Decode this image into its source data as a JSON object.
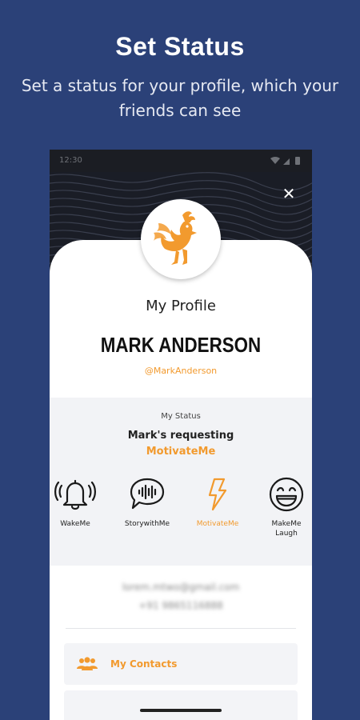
{
  "promo": {
    "title": "Set Status",
    "subtitle": "Set a status for your profile, which your friends can see"
  },
  "status_bar": {
    "time": "12:30"
  },
  "profile": {
    "heading": "My Profile",
    "name": "MARK ANDERSON",
    "handle": "@MarkAnderson"
  },
  "status": {
    "title": "My Status",
    "line": "Mark's  requesting",
    "value": "MotivateMe",
    "options": [
      {
        "label": "WakeMe",
        "icon": "bell-icon"
      },
      {
        "label": "StorywithMe",
        "icon": "speech-bubble-waveform-icon"
      },
      {
        "label": "MotivateMe",
        "icon": "lightning-bolt-icon",
        "selected": true
      },
      {
        "label": "MakeMe Laugh",
        "icon": "laughing-face-icon"
      }
    ]
  },
  "contact_info": {
    "email": "lorem.mtwo@gmail.com",
    "phone": "+91 9865116888"
  },
  "menu": {
    "contacts_label": "My Contacts"
  },
  "colors": {
    "background": "#2b4178",
    "accent": "#f29a2e",
    "header": "#1a1d26"
  }
}
